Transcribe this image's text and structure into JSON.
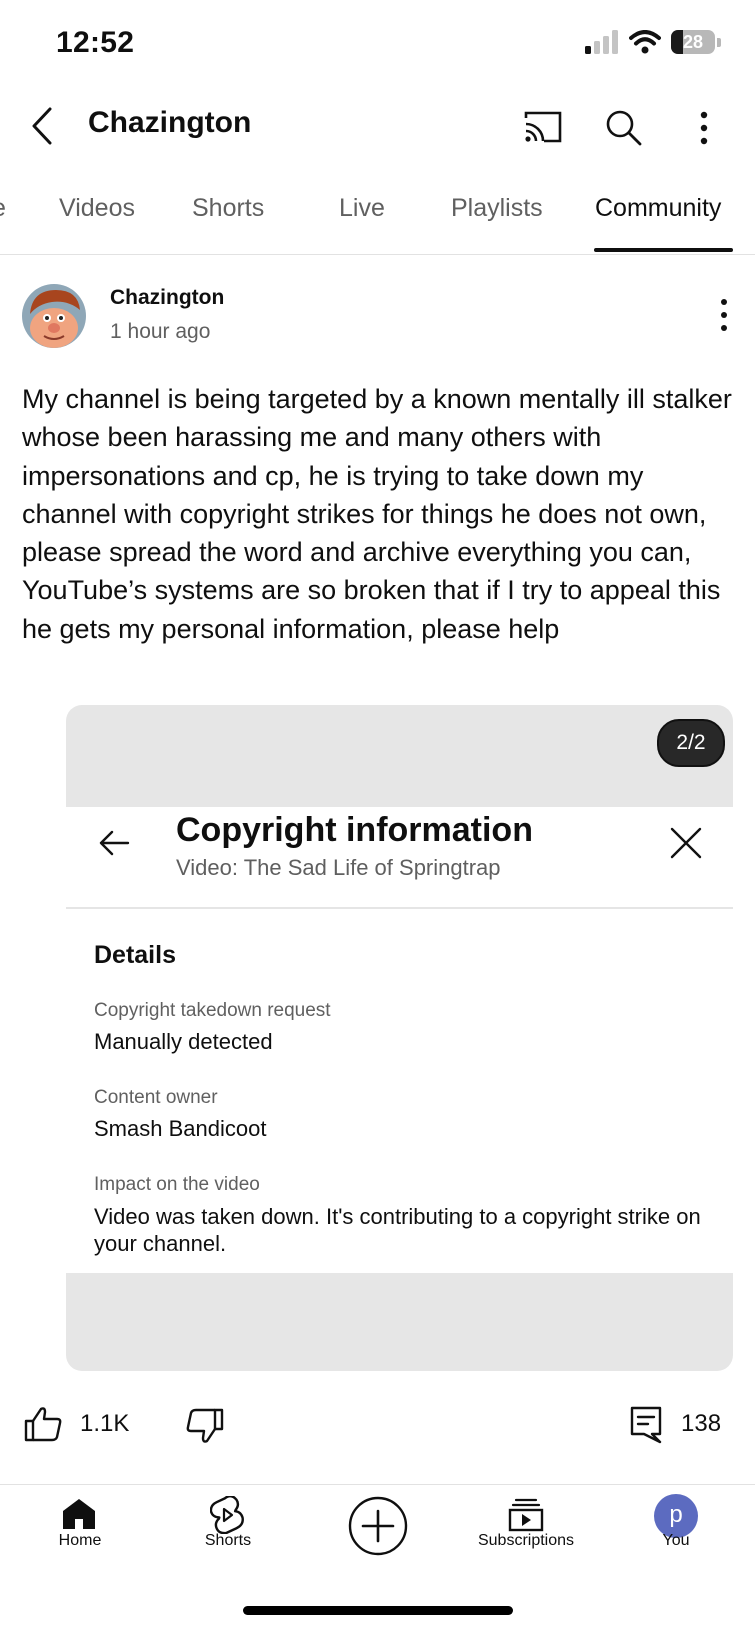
{
  "status_bar": {
    "time": "12:52",
    "battery": "28",
    "battery_level": 0.28
  },
  "header": {
    "title": "Chazington",
    "icons": [
      "back-icon",
      "cast-icon",
      "search-icon",
      "more-vert-icon"
    ]
  },
  "tabs": [
    {
      "label": "Videos",
      "active": false
    },
    {
      "label": "Shorts",
      "active": false
    },
    {
      "label": "Live",
      "active": false
    },
    {
      "label": "Playlists",
      "active": false
    },
    {
      "label": "Community",
      "active": true
    }
  ],
  "post": {
    "author": "Chazington",
    "time": "1 hour ago",
    "text": "My channel is being targeted by a known mentally ill stalker whose been harassing me and many others with impersonations and cp, he is trying to take down my channel with copyright strikes for things he does not own, please spread the word and archive everything you can, YouTube’s systems are so broken that if I try to appeal this he gets my personal information, please help",
    "image": {
      "counter": "2/2",
      "title": "Copyright information",
      "subtitle": "Video: The Sad Life of Springtrap",
      "details_heading": "Details",
      "rows": [
        {
          "label": "Copyright takedown request",
          "value": "Manually detected"
        },
        {
          "label": "Content owner",
          "value": "Smash Bandicoot"
        },
        {
          "label": "Impact on the video",
          "value": "Video was taken down. It's contributing to a copyright strike on your channel."
        }
      ]
    },
    "likes": "1.1K",
    "comments": "138"
  },
  "bottom_nav": {
    "home": "Home",
    "shorts": "Shorts",
    "subscriptions": "Subscriptions",
    "you": "You",
    "you_initial": "p"
  },
  "colors": {
    "you_avatar": "#5c6bc0",
    "card_bg": "#e6e6e6",
    "secondary_text": "#606060"
  }
}
